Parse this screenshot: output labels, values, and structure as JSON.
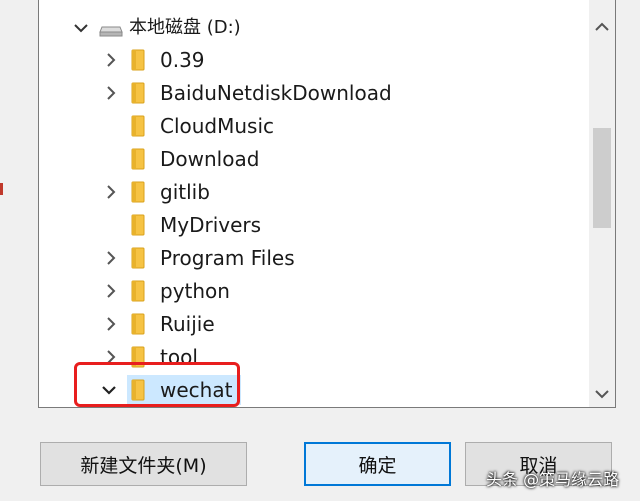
{
  "drive": {
    "label": "本地磁盘 (D:)"
  },
  "folders": [
    {
      "name": "0.39",
      "expandable": true
    },
    {
      "name": "BaiduNetdiskDownload",
      "expandable": true
    },
    {
      "name": "CloudMusic",
      "expandable": false
    },
    {
      "name": "Download",
      "expandable": false
    },
    {
      "name": "gitlib",
      "expandable": true
    },
    {
      "name": "MyDrivers",
      "expandable": false
    },
    {
      "name": "Program Files",
      "expandable": true
    },
    {
      "name": "python",
      "expandable": true
    },
    {
      "name": "Ruijie",
      "expandable": true
    },
    {
      "name": "tool",
      "expandable": true
    },
    {
      "name": "wechat",
      "expandable": true,
      "expanded": true,
      "selected": true
    }
  ],
  "buttons": {
    "new_folder": "新建文件夹(M)",
    "ok": "确定",
    "cancel": "取消"
  },
  "watermark": "头条 @策马缘云路",
  "colors": {
    "selection_highlight": "#cce8ff",
    "annotation_box": "#e81e1e",
    "folder_yellow": "#f6c344",
    "ok_border": "#0078d7"
  },
  "icons": {
    "expand_collapsed": "chevron-right-icon",
    "expand_open": "chevron-down-icon",
    "folder": "folder-icon",
    "drive": "drive-icon"
  }
}
